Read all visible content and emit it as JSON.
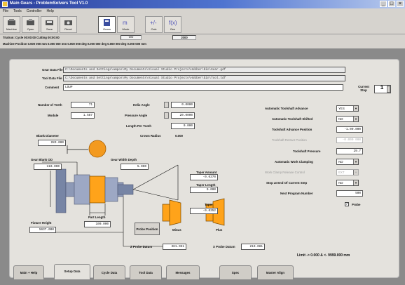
{
  "window": {
    "title": "Main Gears - ProblemSolvers Tool V1.0"
  },
  "menu": [
    "File",
    "Tools",
    "Controller",
    "Help"
  ],
  "toolbar": [
    {
      "label": "Machine",
      "icon": "machine-icon"
    },
    {
      "label": "Open",
      "icon": "open-icon"
    },
    {
      "label": "Save",
      "icon": "save-icon"
    },
    {
      "label": "Reset",
      "icon": "reset-icon"
    },
    {
      "label": "Gears",
      "icon": "gear-calc-icon"
    },
    {
      "label": "Mode",
      "icon": "mode-icon"
    },
    {
      "label": "Calc",
      "icon": "calc-icon"
    },
    {
      "label": "Gen",
      "icon": "generate-icon"
    }
  ],
  "status": {
    "line1": "Trialrun: Cycle 00:00:00  Cutting 00:00:00",
    "cell1": "****",
    "cell2": "2000",
    "line2": "Machine Position  0.000 000 mm   0.000 000 mm   0.000 000 deg   0.000 000 deg   0.000 000 deg   0.000 000 mm"
  },
  "files": {
    "gear_label": "Gear Data File",
    "gear_path": "C:\\Documents and Settings\\ampos\\My Documents\\Visual Studio Projects\\Hobber\\bin\\Gear.gdf",
    "tool_label": "Tool Data File",
    "tool_path": "C:\\Documents and Settings\\ampos\\My Documents\\Visual Studio Projects\\Hobber\\bin\\Tool.tdf",
    "comment_label": "Comment",
    "comment_value": "LOUP",
    "current_step_label": "Current Step",
    "current_step_value": "1"
  },
  "gear": {
    "teeth_label": "Number of Teeth",
    "teeth_value": "71",
    "module_label": "Module",
    "module_value": "1.587",
    "helix_label": "Helix Angle",
    "helix_value": "0.0000",
    "pressure_label": "Pressure Angle",
    "pressure_value": "20.0000",
    "length_label": "Length Per Tooth",
    "length_value": "0.000",
    "crown_label": "Crown Radius",
    "crown_value": "0.000"
  },
  "right": {
    "auto_adv_label": "Automatic Toolshaft Advance",
    "auto_adv_value": "YES",
    "auto_shift_label": "Automatic Toolshaft Shifted",
    "auto_shift_value": "NO",
    "adv_pos_label": "Toolshaft Advance Position",
    "adv_pos_value": "-1.00.000",
    "ret_pos_label": "Toolshaft Retract Position",
    "ret_pos_value": "-0.000 000",
    "pressure_label": "Toolshaft Pressure",
    "pressure_value": "29.7",
    "clamp_label": "Automatic Work Clamping",
    "clamp_value": "NO",
    "clamp_sel_label": "Work Clamp Release Control",
    "clamp_sel_value": "EXT",
    "stop_label": "Stop at End Of Current Step",
    "stop_value": "NO",
    "prog_label": "Next Program Number",
    "prog_value": "500",
    "probe_label": "Probe"
  },
  "diagram": {
    "blank_label": "Blank Diameter",
    "blank_value": "283.000",
    "od_label": "Gear Blank OD",
    "od_value": "110.000",
    "width_label": "Gear Width Depth",
    "width_value": "5.000",
    "taper_a_label": "Taper Amount",
    "taper_a_value": "-0.0370",
    "taper_l_label": "Taper Length",
    "taper_l_value": "0.000",
    "taper_label": "Taper",
    "taper_value": "-0.0352",
    "fixture_label": "Fixture Height",
    "fixture_value": "5637.000",
    "part_label": "Part Length",
    "part_value": "100.000",
    "probe_pos_label": "Probe Position",
    "minus_label": "Minus",
    "plus_label": "Plus",
    "z_probe_label": "Z Probe Datum",
    "z_probe_value": "381.051",
    "x_probe_label": "X Probe Datum",
    "x_probe_value": "210.081",
    "limit_text": "Limit -> 0.000 & <- 9999.000 mm"
  },
  "tabs": [
    "Main + Help",
    "Setup Data",
    "Cycle Data",
    "Tool Data",
    "Messages",
    "Spec",
    "Master Align"
  ],
  "active_tab": 1,
  "colors": {
    "title_start": "#2b3f9c",
    "accent": "#f39a1f",
    "part": "#ffa31a"
  }
}
